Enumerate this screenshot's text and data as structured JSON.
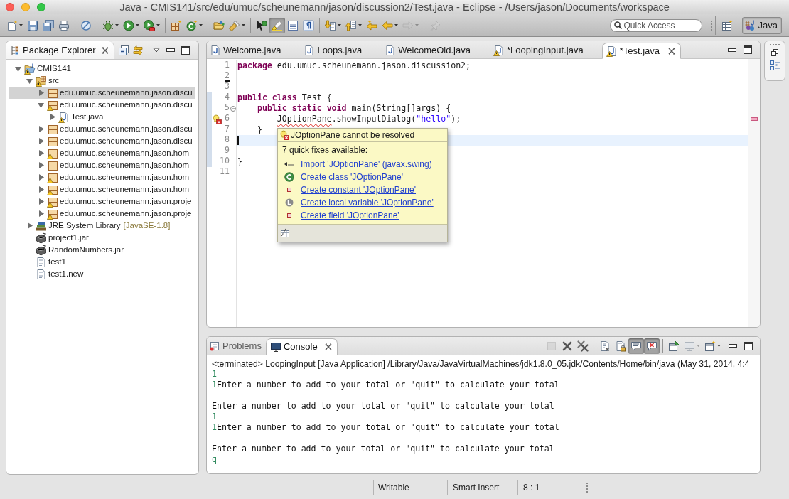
{
  "window": {
    "title": "Java - CMIS141/src/edu/umuc/scheunemann/jason/discussion2/Test.java - Eclipse - /Users/jason/Documents/workspace"
  },
  "toolbar": [
    {
      "pressed": false,
      "disabled": false
    },
    {
      "pressed": false,
      "disabled": false
    },
    {
      "pressed": false,
      "disabled": false
    },
    {
      "pressed": false,
      "disabled": false
    },
    {
      "pressed": false,
      "disabled": false
    },
    {
      "pressed": false,
      "disabled": false
    },
    {
      "pressed": false,
      "disabled": false
    },
    {
      "pressed": false,
      "disabled": false
    },
    {
      "pressed": false,
      "disabled": false
    },
    {
      "pressed": false,
      "disabled": false
    },
    {
      "pressed": false,
      "disabled": false
    },
    {
      "pressed": false,
      "disabled": false
    },
    {
      "pressed": false,
      "disabled": false
    },
    {
      "pressed": true,
      "disabled": false
    },
    {
      "pressed": false,
      "disabled": false
    },
    {
      "pressed": false,
      "disabled": false
    },
    {
      "pressed": false,
      "disabled": false
    },
    {
      "pressed": false,
      "disabled": false
    },
    {
      "pressed": false,
      "disabled": false
    },
    {
      "pressed": false,
      "disabled": false
    },
    {
      "pressed": false,
      "disabled": true
    },
    {
      "pressed": false,
      "disabled": true
    }
  ],
  "quick_access": {
    "placeholder": "Quick Access"
  },
  "perspectives": [
    {
      "label": "Java",
      "selected": true
    }
  ],
  "package_explorer": {
    "title": "Package Explorer",
    "items": [
      {
        "label": "CMIS141",
        "kind": "project",
        "expanded": true,
        "selected": false,
        "warning": true,
        "children": [
          {
            "label": "src",
            "kind": "source_folder",
            "expanded": true,
            "selected": false,
            "warning": true,
            "children": [
              {
                "label": "edu.umuc.scheunemann.jason.discu",
                "kind": "package",
                "expanded": false,
                "selected": true,
                "warning": false
              },
              {
                "label": "edu.umuc.scheunemann.jason.discu",
                "kind": "package",
                "expanded": true,
                "selected": false,
                "warning": true,
                "children": [
                  {
                    "label": "Test.java",
                    "kind": "java_file",
                    "expanded": false,
                    "selected": false,
                    "warning": true
                  }
                ]
              },
              {
                "label": "edu.umuc.scheunemann.jason.discu",
                "kind": "package",
                "expanded": false,
                "selected": false,
                "warning": false
              },
              {
                "label": "edu.umuc.scheunemann.jason.discu",
                "kind": "package",
                "expanded": false,
                "selected": false,
                "warning": false
              },
              {
                "label": "edu.umuc.scheunemann.jason.hom",
                "kind": "package",
                "expanded": false,
                "selected": false,
                "warning": true
              },
              {
                "label": "edu.umuc.scheunemann.jason.hom",
                "kind": "package",
                "expanded": false,
                "selected": false,
                "warning": false
              },
              {
                "label": "edu.umuc.scheunemann.jason.hom",
                "kind": "package",
                "expanded": false,
                "selected": false,
                "warning": true
              },
              {
                "label": "edu.umuc.scheunemann.jason.hom",
                "kind": "package",
                "expanded": false,
                "selected": false,
                "warning": true
              },
              {
                "label": "edu.umuc.scheunemann.jason.proje",
                "kind": "package",
                "expanded": false,
                "selected": false,
                "warning": true
              },
              {
                "label": "edu.umuc.scheunemann.jason.proje",
                "kind": "package",
                "expanded": false,
                "selected": false,
                "warning": true
              }
            ]
          },
          {
            "label": "JRE System Library",
            "detail": "[JavaSE-1.8]",
            "kind": "library",
            "expanded": false,
            "selected": false,
            "warning": false
          },
          {
            "label": "project1.jar",
            "kind": "jar",
            "selected": false,
            "warning": false
          },
          {
            "label": "RandomNumbers.jar",
            "kind": "jar",
            "selected": false,
            "warning": false
          },
          {
            "label": "test1",
            "kind": "file",
            "selected": false,
            "warning": false
          },
          {
            "label": "test1.new",
            "kind": "file",
            "selected": false,
            "warning": false
          }
        ]
      }
    ]
  },
  "editor": {
    "tabs": [
      {
        "label": "Welcome.java",
        "selected": false,
        "warning": false
      },
      {
        "label": "Loops.java",
        "selected": false,
        "warning": false
      },
      {
        "label": "WelcomeOld.java",
        "selected": false,
        "warning": false
      },
      {
        "label": "*LoopingInput.java",
        "selected": false,
        "warning": true
      },
      {
        "label": "*Test.java",
        "selected": true,
        "warning": true
      }
    ],
    "lines": [
      {
        "number": "1",
        "current": false,
        "changed": false,
        "deleted": false,
        "error": false,
        "segments": [
          {
            "kind": "keyword",
            "text": "package"
          },
          {
            "kind": "plain",
            "text": " edu.umuc.scheunemann.jason.discussion2;"
          }
        ]
      },
      {
        "number": "2",
        "current": false,
        "changed": false,
        "deleted": true,
        "error": false
      },
      {
        "number": "3",
        "current": false,
        "changed": false,
        "deleted": false,
        "error": false
      },
      {
        "number": "4",
        "current": false,
        "changed": true,
        "deleted": false,
        "error": false,
        "segments": [
          {
            "kind": "keyword",
            "text": "public class"
          },
          {
            "kind": "plain",
            "text": " Test {"
          }
        ]
      },
      {
        "number": "5",
        "current": false,
        "changed": true,
        "deleted": false,
        "error": false,
        "expanded": true,
        "segments": [
          {
            "kind": "keyword",
            "text": "    public static void"
          },
          {
            "kind": "plain",
            "text": " main(String[]args) {"
          }
        ]
      },
      {
        "number": "6",
        "current": false,
        "changed": true,
        "deleted": false,
        "error": true,
        "segments": [
          {
            "kind": "error",
            "text": "        JOptionPane"
          },
          {
            "kind": "plain",
            "text": ".showInputDialog("
          },
          {
            "kind": "string",
            "text": "\"hello\""
          },
          {
            "kind": "plain",
            "text": ");"
          }
        ]
      },
      {
        "number": "7",
        "current": false,
        "changed": true,
        "deleted": false,
        "error": false,
        "segments": [
          {
            "kind": "plain",
            "text": "    }"
          }
        ]
      },
      {
        "number": "8",
        "current": true,
        "changed": true,
        "deleted": false,
        "error": false
      },
      {
        "number": "9",
        "current": false,
        "changed": true,
        "deleted": false,
        "error": false
      },
      {
        "number": "10",
        "current": false,
        "changed": true,
        "deleted": false,
        "error": false,
        "segments": [
          {
            "kind": "plain",
            "text": "}"
          }
        ]
      },
      {
        "number": "11",
        "current": false,
        "changed": false,
        "deleted": false,
        "error": false
      }
    ],
    "quick_fix": {
      "problem": "JOptionPane cannot be resolved",
      "summary": "7 quick fixes available:",
      "fixes": [
        {
          "kind": "import",
          "label": "Import 'JOptionPane' (javax.swing)"
        },
        {
          "kind": "class",
          "label": "Create class 'JOptionPane'"
        },
        {
          "kind": "constant",
          "label": "Create constant 'JOptionPane'"
        },
        {
          "kind": "local_variable",
          "label": "Create local variable 'JOptionPane'"
        },
        {
          "kind": "field",
          "label": "Create field 'JOptionPane'"
        }
      ]
    }
  },
  "console_view": {
    "tabs": [
      {
        "label": "Problems",
        "selected": false
      },
      {
        "label": "Console",
        "selected": true
      }
    ],
    "toolbar": [
      {
        "pressed": false,
        "disabled": true
      },
      {
        "pressed": false,
        "disabled": false
      },
      {
        "pressed": false,
        "disabled": false
      },
      {
        "pressed": false,
        "disabled": false
      },
      {
        "pressed": false,
        "disabled": false
      },
      {
        "pressed": true,
        "disabled": false
      },
      {
        "pressed": true,
        "disabled": false
      },
      {
        "pressed": false,
        "disabled": false
      },
      {
        "pressed": false,
        "disabled": true
      },
      {
        "pressed": false,
        "disabled": false
      }
    ],
    "header": "<terminated> LoopingInput [Java Application] /Library/Java/JavaVirtualMachines/jdk1.8.0_05.jdk/Contents/Home/bin/java (May 31, 2014, 4:4",
    "lines": [
      {
        "kind": "text",
        "segments": [
          {
            "kind": "input",
            "text": "1"
          }
        ]
      },
      {
        "kind": "text",
        "segments": [
          {
            "kind": "input",
            "text": "1"
          },
          {
            "kind": "output",
            "text": "Enter a number to add to your total or \"quit\" to calculate your total"
          }
        ]
      },
      {
        "kind": "blank"
      },
      {
        "kind": "text",
        "segments": [
          {
            "kind": "output",
            "text": "Enter a number to add to your total or \"quit\" to calculate your total"
          }
        ]
      },
      {
        "kind": "text",
        "segments": [
          {
            "kind": "input",
            "text": "1"
          }
        ]
      },
      {
        "kind": "text",
        "segments": [
          {
            "kind": "input",
            "text": "1"
          },
          {
            "kind": "output",
            "text": "Enter a number to add to your total or \"quit\" to calculate your total"
          }
        ]
      },
      {
        "kind": "blank"
      },
      {
        "kind": "text",
        "segments": [
          {
            "kind": "output",
            "text": "Enter a number to add to your total or \"quit\" to calculate your total"
          }
        ]
      },
      {
        "kind": "text",
        "segments": [
          {
            "kind": "input",
            "text": "q"
          }
        ]
      }
    ]
  },
  "status_bar": [
    "Writable",
    "Smart Insert",
    "8 : 1"
  ]
}
